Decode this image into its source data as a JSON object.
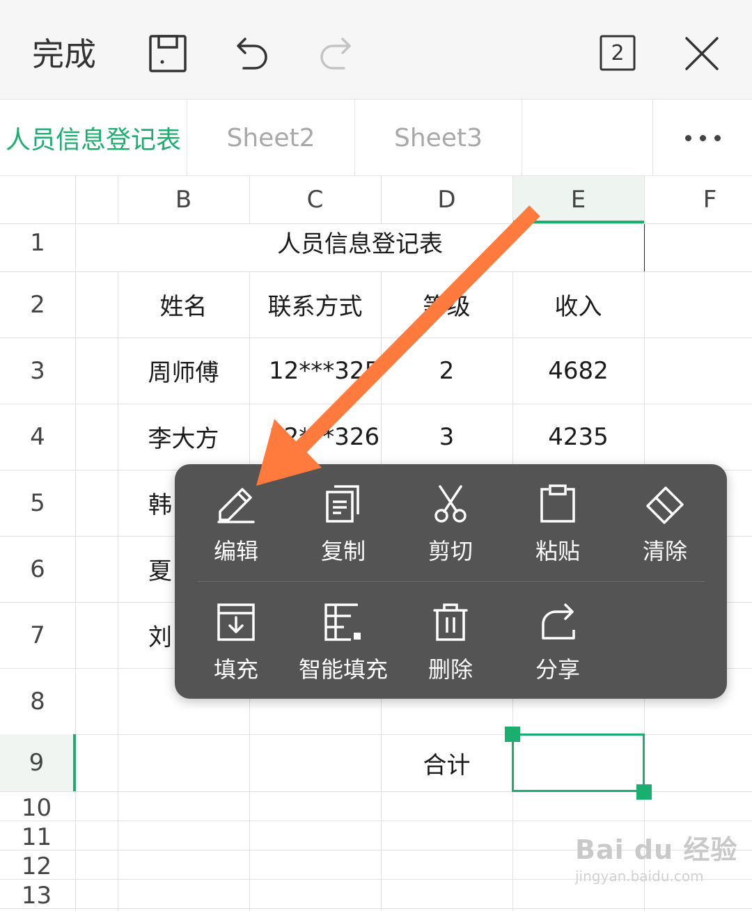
{
  "toolbar": {
    "done_label": "完成",
    "page_count": "2",
    "icons": [
      "save-icon",
      "undo-icon",
      "redo-icon",
      "sheet-count-icon",
      "close-icon"
    ]
  },
  "sheet_tabs": {
    "tabs": [
      "人员信息登记表",
      "Sheet2",
      "Sheet3"
    ],
    "active": "人员信息登记表",
    "more_icon": "more-icon"
  },
  "grid": {
    "column_headers": [
      "B",
      "C",
      "D",
      "E",
      "F"
    ],
    "row_headers": [
      "1",
      "2",
      "3",
      "4",
      "5",
      "6",
      "7",
      "8",
      "9",
      "10",
      "11",
      "12",
      "13"
    ],
    "title": "人员信息登记表",
    "headers": {
      "name": "姓名",
      "contact": "联系方式",
      "level": "等级",
      "income": "收入"
    },
    "rows": [
      {
        "name": "周师傅",
        "contact": "12***325",
        "level": "2",
        "income": "4682"
      },
      {
        "name": "李大方",
        "contact": "12***326",
        "level": "3",
        "income": "4235"
      },
      {
        "name": "韩"
      },
      {
        "name": "夏"
      },
      {
        "name": "刘"
      }
    ],
    "total_label": "合计",
    "selected_cell": "E9"
  },
  "context_menu": {
    "items": [
      {
        "label": "编辑",
        "icon": "pencil-icon"
      },
      {
        "label": "复制",
        "icon": "copy-icon"
      },
      {
        "label": "剪切",
        "icon": "scissors-icon"
      },
      {
        "label": "粘贴",
        "icon": "clipboard-icon"
      },
      {
        "label": "清除",
        "icon": "eraser-icon"
      },
      {
        "label": "填充",
        "icon": "fill-icon"
      },
      {
        "label": "智能填充",
        "icon": "smart-fill-icon"
      },
      {
        "label": "删除",
        "icon": "trash-icon"
      },
      {
        "label": "分享",
        "icon": "share-icon"
      }
    ]
  },
  "annotation": {
    "type": "arrow",
    "color": "#ff7a3d",
    "points_to": "编辑"
  },
  "watermark": {
    "main": "Bai du 经验",
    "sub": "jingyan.baidu.com"
  },
  "colors": {
    "accent": "#1aae6f",
    "menu_bg": "#545454",
    "arrow": "#ff7a3d"
  }
}
